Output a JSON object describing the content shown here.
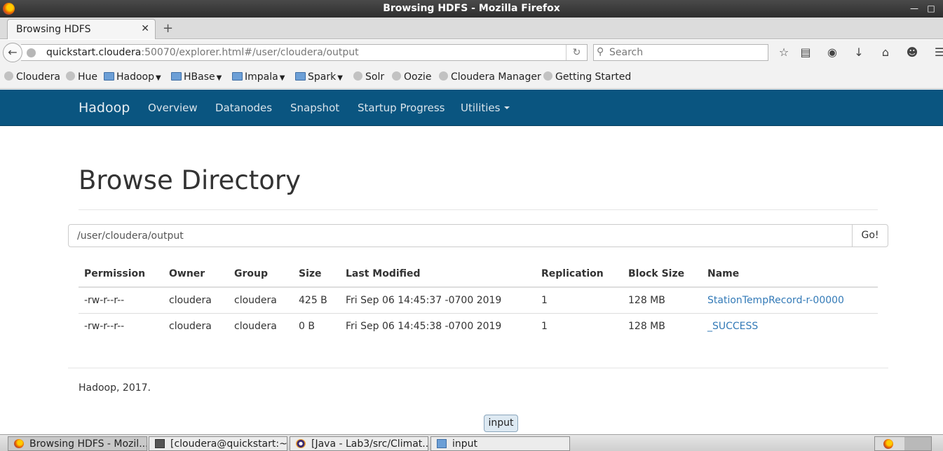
{
  "window": {
    "title": "Browsing HDFS - Mozilla Firefox"
  },
  "browser": {
    "tab_label": "Browsing HDFS",
    "url_host": "quickstart.cloudera",
    "url_rest": ":50070/explorer.html#/user/cloudera/output",
    "search_placeholder": "Search"
  },
  "bookmarks": [
    {
      "label": "Cloudera",
      "icon": "globe-icon",
      "folder": false
    },
    {
      "label": "Hue",
      "icon": "globe-icon",
      "folder": false
    },
    {
      "label": "Hadoop",
      "icon": "folder-icon",
      "folder": true
    },
    {
      "label": "HBase",
      "icon": "folder-icon",
      "folder": true
    },
    {
      "label": "Impala",
      "icon": "folder-icon",
      "folder": true
    },
    {
      "label": "Spark",
      "icon": "folder-icon",
      "folder": true
    },
    {
      "label": "Solr",
      "icon": "globe-icon",
      "folder": false
    },
    {
      "label": "Oozie",
      "icon": "globe-icon",
      "folder": false
    },
    {
      "label": "Cloudera Manager",
      "icon": "globe-icon",
      "folder": false
    },
    {
      "label": "Getting Started",
      "icon": "globe-icon",
      "folder": false
    }
  ],
  "hadoop_nav": {
    "brand": "Hadoop",
    "items": [
      "Overview",
      "Datanodes",
      "Snapshot",
      "Startup Progress",
      "Utilities"
    ]
  },
  "main": {
    "title": "Browse Directory",
    "path_value": "/user/cloudera/output",
    "go_label": "Go!",
    "columns": [
      "Permission",
      "Owner",
      "Group",
      "Size",
      "Last Modified",
      "Replication",
      "Block Size",
      "Name"
    ],
    "rows": [
      [
        "-rw-r--r--",
        "cloudera",
        "cloudera",
        "425 B",
        "Fri Sep 06 14:45:37 -0700 2019",
        "1",
        "128 MB",
        "StationTempRecord-r-00000"
      ],
      [
        "-rw-r--r--",
        "cloudera",
        "cloudera",
        "0 B",
        "Fri Sep 06 14:45:38 -0700 2019",
        "1",
        "128 MB",
        "_SUCCESS"
      ]
    ],
    "footer": "Hadoop, 2017."
  },
  "tooltip": "input",
  "taskbar": [
    {
      "label": "Browsing HDFS - Mozil...",
      "icon": "firefox-icon",
      "active": true
    },
    {
      "label": "[cloudera@quickstart:~]",
      "icon": "terminal-icon",
      "active": false
    },
    {
      "label": "[Java - Lab3/src/Climat...",
      "icon": "eclipse-icon",
      "active": false
    },
    {
      "label": "input",
      "icon": "folder-icon",
      "active": false
    }
  ],
  "colors": {
    "hadoop_nav_bg": "#0a5580",
    "link": "#337ab7"
  }
}
